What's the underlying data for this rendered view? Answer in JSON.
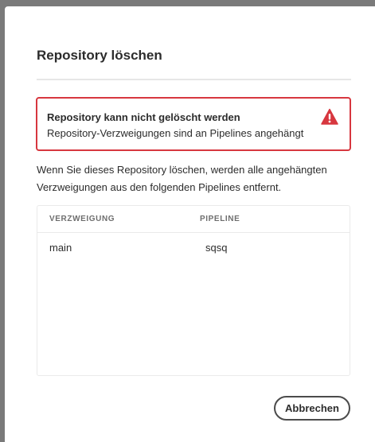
{
  "dialog": {
    "title": "Repository löschen",
    "alert": {
      "heading": "Repository kann nicht gelöscht werden",
      "text": "Repository-Verzweigungen sind an Pipelines angehängt",
      "icon": "alert-triangle-icon",
      "color": "#d7373f"
    },
    "description": "Wenn Sie dieses Repository löschen, werden alle angehängten Verzweigungen aus den folgenden Pipelines entfernt.",
    "table": {
      "columns": [
        "VERZWEIGUNG",
        "PIPELINE"
      ],
      "rows": [
        {
          "branch": "main",
          "pipeline": "sqsq"
        }
      ]
    },
    "cancel_label": "Abbrechen"
  }
}
